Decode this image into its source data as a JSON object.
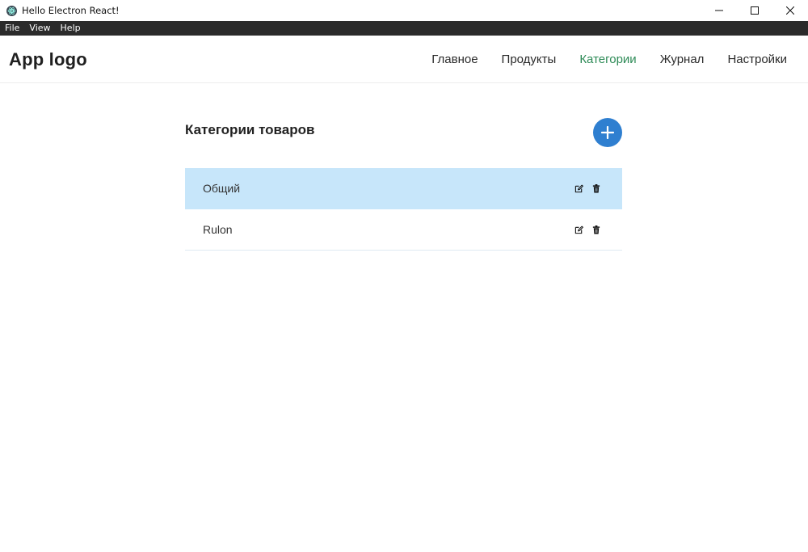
{
  "window": {
    "title": "Hello Electron React!",
    "icon": "electron-icon",
    "controls": [
      "minimize-icon",
      "maximize-icon",
      "close-icon"
    ]
  },
  "menubar": {
    "items": [
      {
        "label": "File"
      },
      {
        "label": "View"
      },
      {
        "label": "Help"
      }
    ]
  },
  "header": {
    "logo": "App logo",
    "nav": [
      {
        "label": "Главное",
        "active": false
      },
      {
        "label": "Продукты",
        "active": false
      },
      {
        "label": "Категории",
        "active": true
      },
      {
        "label": "Журнал",
        "active": false
      },
      {
        "label": "Настройки",
        "active": false
      }
    ]
  },
  "main": {
    "title": "Категории товаров",
    "add_button_icon": "plus-icon",
    "categories": [
      {
        "name": "Общий",
        "selected": true
      },
      {
        "name": "Rulon",
        "selected": false
      }
    ],
    "row_action_icons": [
      "edit-icon",
      "trash-icon"
    ]
  },
  "colors": {
    "accent_active_nav": "#2e8b57",
    "add_button": "#2f7fd0",
    "selected_row": "#c7e6fa",
    "menubar_bg": "#2b2b2b"
  }
}
